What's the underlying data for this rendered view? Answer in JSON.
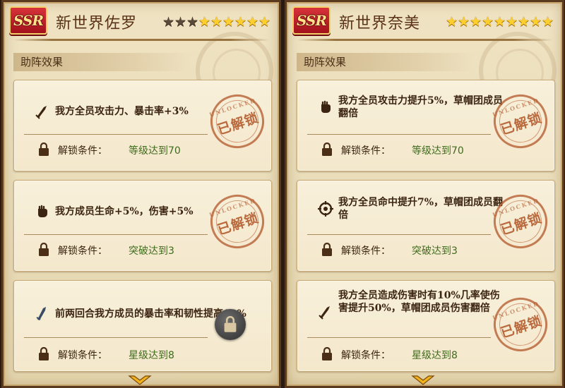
{
  "panels": [
    {
      "rarity": "SSR",
      "name": "新世界佐罗",
      "stars_total": 9,
      "stars_lit": 6,
      "section_label": "助阵效果",
      "cards": [
        {
          "icon": "sword-icon",
          "effect": "我方全员攻击力、暴击率+3%",
          "cond_label": "解锁条件：",
          "cond_value": "等级达到70",
          "unlocked": true,
          "stamp": "已解锁",
          "stamp_small": "UNLOCKED"
        },
        {
          "icon": "fist-icon",
          "effect": "我方成员生命+5%，伤害+5%",
          "cond_label": "解锁条件：",
          "cond_value": "突破达到3",
          "unlocked": true,
          "stamp": "已解锁",
          "stamp_small": "UNLOCKED"
        },
        {
          "icon": "blade-icon",
          "effect": "前两回合我方成员的暴击率和韧性提高10%",
          "cond_label": "解锁条件：",
          "cond_value": "星级达到8",
          "unlocked": false
        }
      ]
    },
    {
      "rarity": "SSR",
      "name": "新世界奈美",
      "stars_total": 9,
      "stars_lit": 9,
      "section_label": "助阵效果",
      "cards": [
        {
          "icon": "fist-icon",
          "effect": "我方全员攻击力提升5%，草帽团成员翻倍",
          "cond_label": "解锁条件：",
          "cond_value": "等级达到70",
          "unlocked": true,
          "stamp": "已解锁",
          "stamp_small": "UNLOCKED"
        },
        {
          "icon": "crosshair-icon",
          "effect": "我方全员命中提升7%，草帽团成员翻倍",
          "cond_label": "解锁条件：",
          "cond_value": "突破达到3",
          "unlocked": true,
          "stamp": "已解锁",
          "stamp_small": "UNLOCKED"
        },
        {
          "icon": "sword-icon",
          "effect": "我方全员造成伤害时有10%几率使伤害提升50%，草帽团成员伤害翻倍",
          "cond_label": "解锁条件：",
          "cond_value": "星级达到8",
          "unlocked": true,
          "stamp": "已解锁",
          "stamp_small": "UNLOCKED"
        }
      ]
    }
  ],
  "colors": {
    "star_lit": "#ffcf2e",
    "star_dim": "#5a4a3a",
    "ssr_badge": "#c21f2a",
    "condition_value": "#3f6b1c",
    "stamp": "#b25628"
  }
}
